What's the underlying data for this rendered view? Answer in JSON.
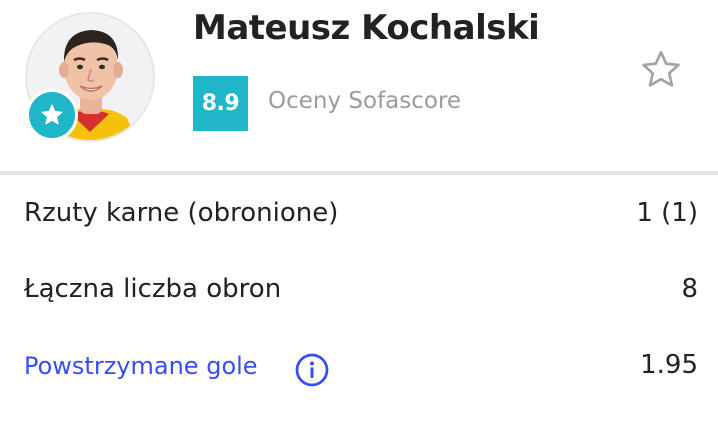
{
  "player": {
    "name": "Mateusz Kochalski",
    "rating": "8.9",
    "rating_source": "Oceny Sofascore",
    "badge_icon": "star-icon",
    "favorite_icon": "star-outline-icon"
  },
  "stats": [
    {
      "label": "Rzuty karne (obronione)",
      "value": "1 (1)"
    },
    {
      "label": "Łączna liczba obron",
      "value": "8"
    },
    {
      "label": "Powstrzymane gole",
      "value": "1.95",
      "info_icon": "info-icon"
    }
  ],
  "colors": {
    "accent": "#1fb6c9",
    "link": "#374df5",
    "text": "#222226",
    "muted": "#9a9aa1",
    "divider": "#e4e4e8"
  }
}
